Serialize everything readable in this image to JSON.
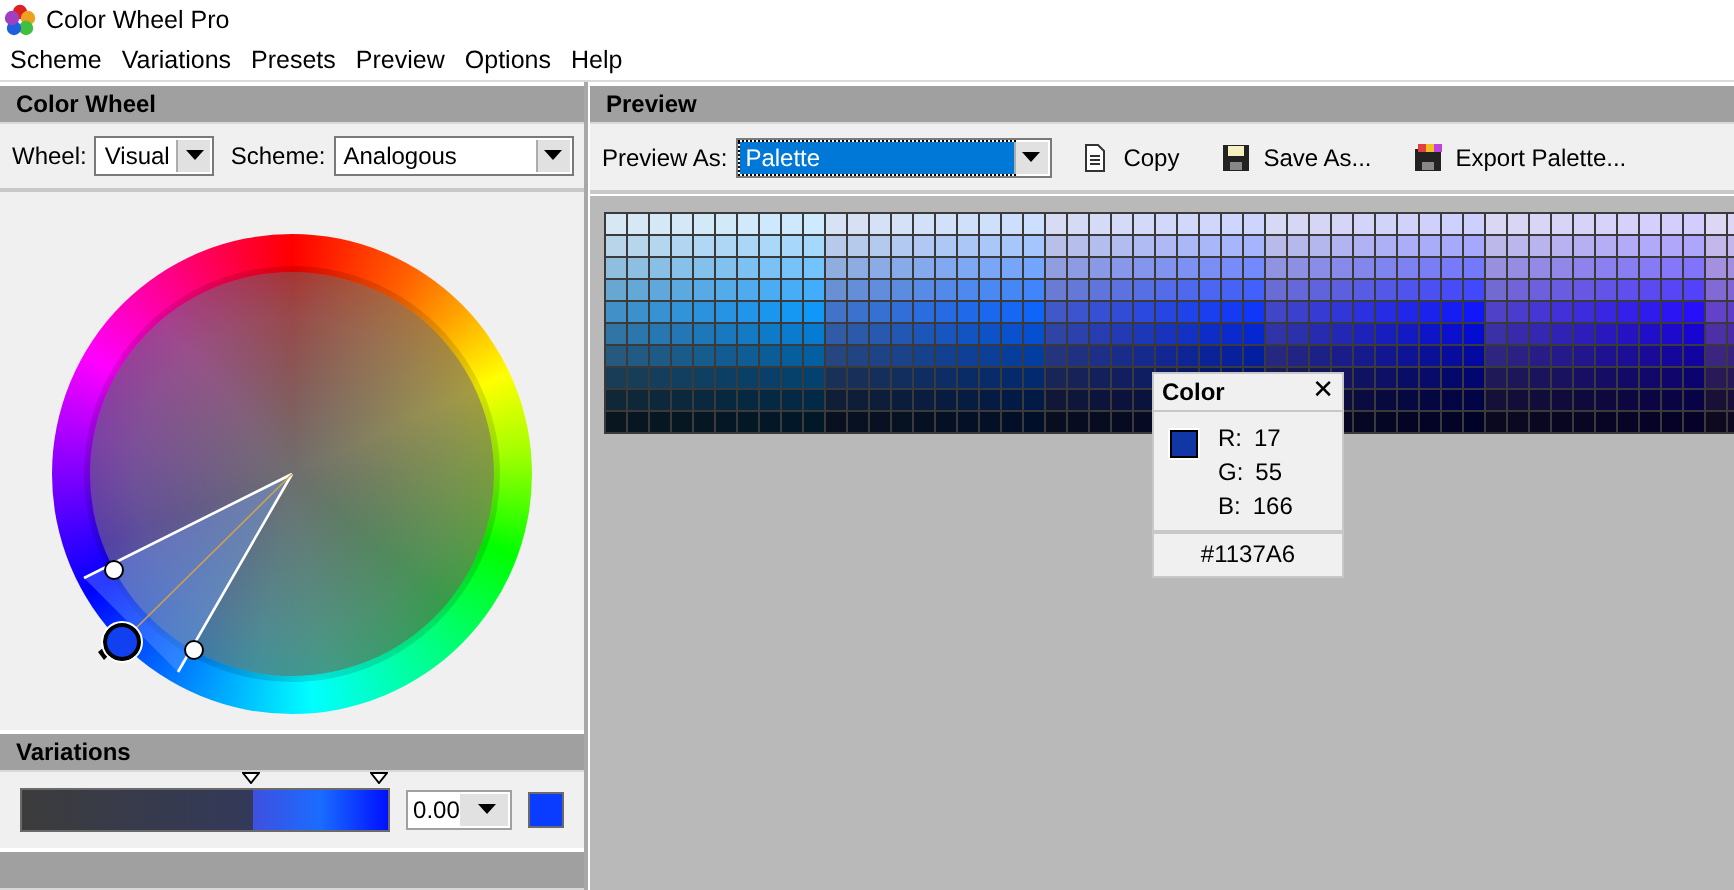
{
  "window": {
    "title": "Color Wheel Pro"
  },
  "menu": [
    "Scheme",
    "Variations",
    "Presets",
    "Preview",
    "Options",
    "Help"
  ],
  "color_wheel_panel": {
    "title": "Color Wheel",
    "wheel_select": {
      "label": "Wheel:",
      "value": "Visual"
    },
    "scheme_select": {
      "label": "Scheme:",
      "value": "Analogous"
    }
  },
  "variations_panel": {
    "title": "Variations",
    "value_field": {
      "value": "0.00"
    },
    "markers": [
      {
        "level": 0.63
      },
      {
        "level": 0.98
      }
    ]
  },
  "preview_panel": {
    "title": "Preview",
    "preview_as": {
      "label": "Preview As:",
      "value": "Palette"
    },
    "buttons": [
      {
        "kind": "copy",
        "label": "Copy"
      },
      {
        "kind": "save",
        "label": "Save As..."
      },
      {
        "kind": "export",
        "label": "Export Palette..."
      }
    ]
  },
  "color_popup": {
    "title": "Color",
    "close": "✕",
    "channels": [
      {
        "label": "R:",
        "value": "17"
      },
      {
        "label": "G:",
        "value": "55"
      },
      {
        "label": "B:",
        "value": "166"
      }
    ],
    "hex": "#1137A6"
  }
}
